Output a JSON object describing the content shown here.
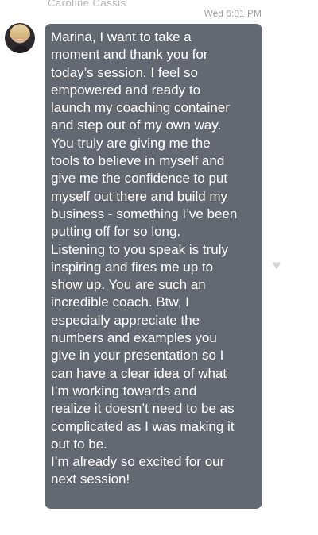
{
  "header": {
    "sender_name": "Caroline Cassis",
    "timestamp": "Wed 6:01 PM"
  },
  "message": {
    "part1": "Marina, I want to take a\nmoment and thank you for\n",
    "underlined_word": "today",
    "part2": "’s session. I feel so\nempowered and ready to\nlaunch my coaching container\nand step out of my own way.\nYou truly are giving me the\ntools to believe in myself and\ngive me the confidence to put\nmyself out there and build my\nbusiness - something I’ve been\nputting off for so long.\nListening to you speak is truly\ninspiring and fires me up to\nshow up. You are such an\nincredible coach. Btw,  I\nespecially appreciate the\nnumbers and examples you\ngive in your presentation so I\ncan have a clear idea of what\nI’m working towards and\nrealize it doesn’t need to be as\ncomplicated as I was making it\nout to be.\nI’m already so excited for our\nnext session!"
  },
  "icons": {
    "reaction": "heart-icon",
    "avatar": "avatar-photo"
  },
  "colors": {
    "bubble": "#646870",
    "text": "#ffffff",
    "timestamp": "#9d9d9d",
    "heart": "#d7d7d7"
  }
}
